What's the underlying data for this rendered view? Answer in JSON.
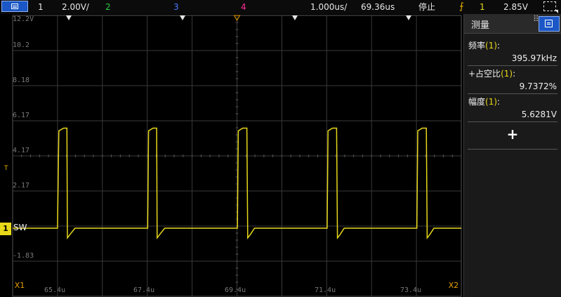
{
  "topbar": {
    "ch1_num": "1",
    "ch1_scale": "2.00V/",
    "ch2_num": "2",
    "ch3_num": "3",
    "ch4_num": "4",
    "timebase": "1.000us/",
    "position": "69.36us",
    "run_state": "停止",
    "trig_source": "1",
    "trig_level": "2.85V",
    "trig_icon": "trigger-edge-icon",
    "colors": {
      "ch1": "#e8d81a",
      "ch2": "#2ecc40",
      "ch3": "#4a7bff",
      "ch4": "#ff2d95",
      "accent": "#1b57c6"
    }
  },
  "screen": {
    "y_labels": [
      "12.2V",
      "10.2",
      "8.18",
      "6.17",
      "4.17",
      "2.17",
      "",
      "-1.83"
    ],
    "x_labels": [
      "65.4u",
      "67.4u",
      "69.4u",
      "71.4u",
      "73.4u"
    ],
    "channel_marker": "1",
    "channel_label": "SW",
    "trigger_marker": "T",
    "cursor_left": "X1",
    "cursor_right": "X2"
  },
  "panel": {
    "title": "测量",
    "measurements": [
      {
        "label": "频率",
        "channel": "(1)",
        "suffix": ":",
        "value": "395.97kHz"
      },
      {
        "label": "+占空比",
        "channel": "(1)",
        "suffix": ":",
        "value": "9.7372%"
      },
      {
        "label": "幅度",
        "channel": "(1)",
        "suffix": ":",
        "value": "5.6281V"
      }
    ],
    "add_label": "+"
  },
  "chart_data": {
    "type": "line",
    "title": "",
    "xlabel": "",
    "ylabel": "",
    "x_ticks": [
      "65.4u",
      "67.4u",
      "69.4u",
      "71.4u",
      "73.4u"
    ],
    "y_ticks": [
      "12.2V",
      "10.2",
      "8.18",
      "6.17",
      "4.17",
      "2.17",
      "-1.83"
    ],
    "xlim": [
      64.36,
      74.36
    ],
    "ylim": [
      -3.83,
      12.17
    ],
    "grid": true,
    "series": [
      {
        "channel": "1",
        "color": "#e8d81a",
        "x": [
          64.36,
          65.36,
          65.39,
          65.5,
          65.57,
          65.58,
          65.64,
          65.75,
          67.37,
          67.39,
          67.49,
          67.57,
          67.58,
          67.64,
          67.75,
          69.37,
          69.39,
          69.49,
          69.58,
          69.6,
          69.66,
          69.75,
          71.37,
          71.39,
          71.49,
          71.58,
          71.6,
          71.66,
          71.75,
          73.37,
          73.39,
          73.49,
          73.58,
          73.6,
          73.66,
          73.75,
          74.36
        ],
        "values": [
          0.05,
          0.05,
          5.6,
          5.75,
          5.75,
          -0.5,
          -0.3,
          0.05,
          0.05,
          5.6,
          5.75,
          5.75,
          -0.5,
          -0.3,
          0.05,
          0.05,
          5.6,
          5.75,
          5.75,
          -0.5,
          -0.3,
          0.05,
          0.05,
          5.6,
          5.75,
          5.75,
          -0.5,
          -0.3,
          0.05,
          0.05,
          5.6,
          5.75,
          5.75,
          -0.5,
          -0.3,
          0.05,
          0.05
        ]
      }
    ]
  }
}
